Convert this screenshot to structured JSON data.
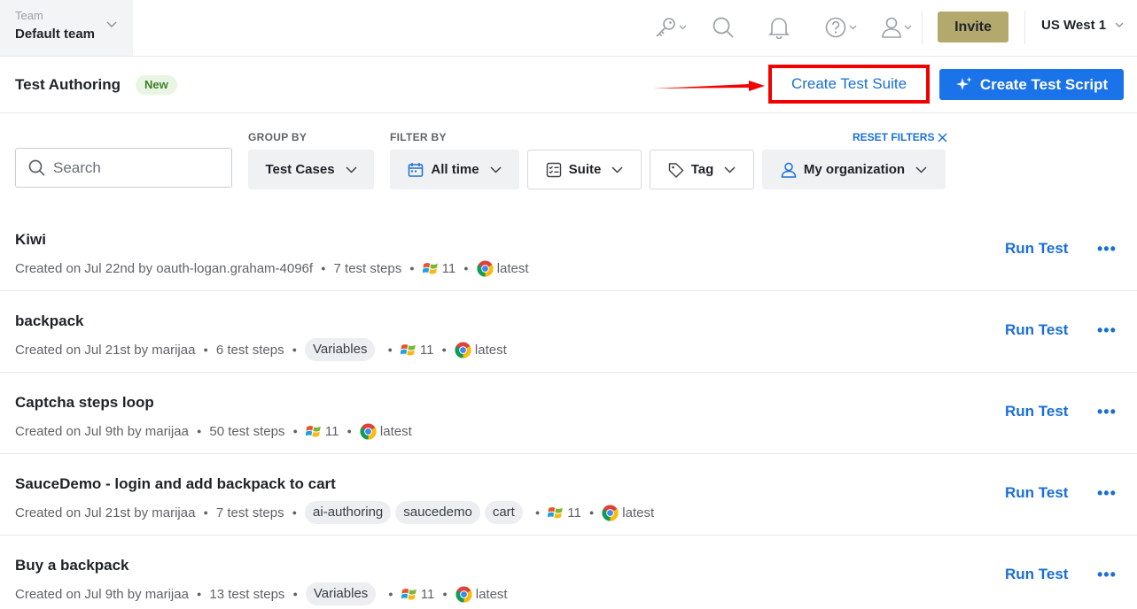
{
  "topbar": {
    "team_label": "Team",
    "team_name": "Default team",
    "invite_label": "Invite",
    "region": "US West 1"
  },
  "subheader": {
    "title": "Test Authoring",
    "badge": "New",
    "create_suite_label": "Create Test Suite",
    "create_script_label": "Create Test Script"
  },
  "filters": {
    "search_placeholder": "Search",
    "group_by_label": "GROUP BY",
    "filter_by_label": "FILTER BY",
    "reset_label": "RESET FILTERS",
    "group_by_value": "Test Cases",
    "time_value": "All time",
    "suite_value": "Suite",
    "tag_value": "Tag",
    "org_value": "My organization"
  },
  "colors": {
    "accent": "#1a73e8",
    "link": "#1a6fd6",
    "invite": "#b3a96d",
    "highlight": "#f20000"
  },
  "tests": [
    {
      "title": "Kiwi",
      "created": "Created on Jul 22nd by oauth-logan.graham-4096f",
      "steps": "7 test steps",
      "tags": [],
      "os": "11",
      "browser": "latest",
      "run_label": "Run Test"
    },
    {
      "title": "backpack",
      "created": "Created on Jul 21st by marijaa",
      "steps": "6 test steps",
      "tags": [
        "Variables"
      ],
      "os": "11",
      "browser": "latest",
      "run_label": "Run Test"
    },
    {
      "title": "Captcha steps loop",
      "created": "Created on Jul 9th by marijaa",
      "steps": "50 test steps",
      "tags": [],
      "os": "11",
      "browser": "latest",
      "run_label": "Run Test"
    },
    {
      "title": "SauceDemo - login and add backpack to cart",
      "created": "Created on Jul 21st by marijaa",
      "steps": "7 test steps",
      "tags": [
        "ai-authoring",
        "saucedemo",
        "cart"
      ],
      "os": "11",
      "browser": "latest",
      "run_label": "Run Test"
    },
    {
      "title": "Buy a backpack",
      "created": "Created on Jul 9th by marijaa",
      "steps": "13 test steps",
      "tags": [
        "Variables"
      ],
      "os": "11",
      "browser": "latest",
      "run_label": "Run Test"
    }
  ]
}
